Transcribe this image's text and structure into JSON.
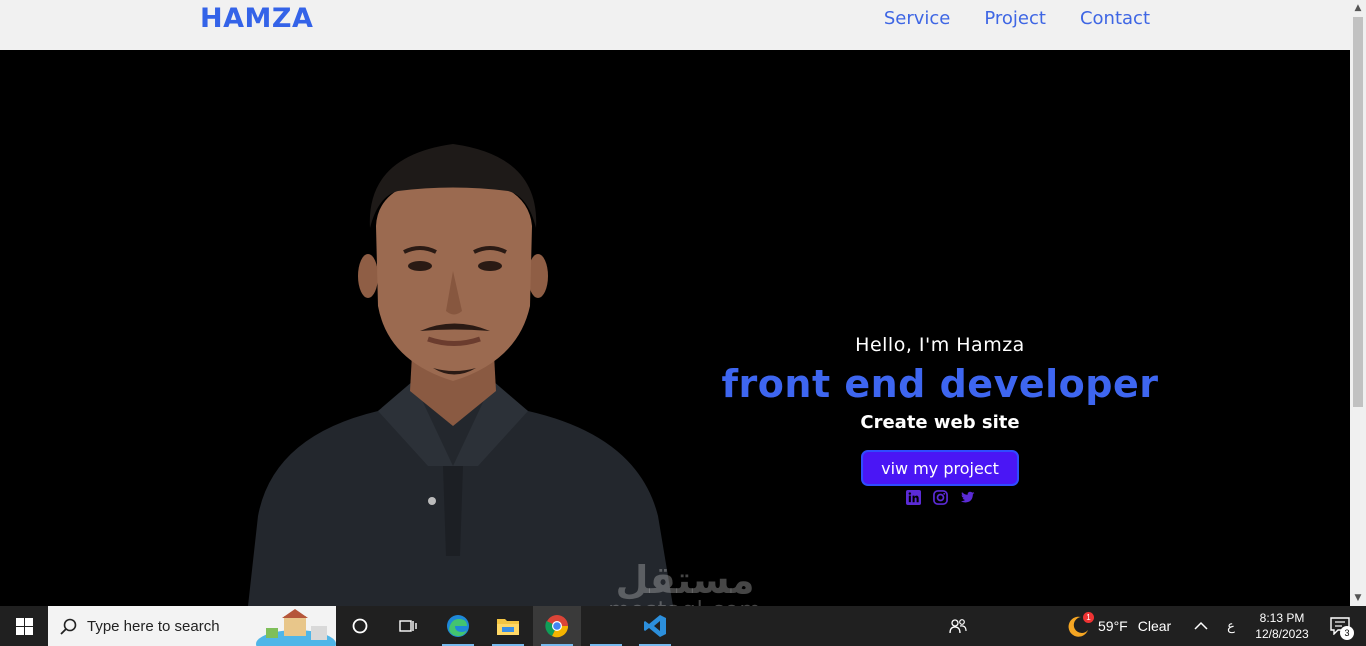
{
  "header": {
    "logo": "HAMZA",
    "nav": [
      "Service",
      "Project",
      "Contact"
    ]
  },
  "hero": {
    "greeting": "Hello, I'm Hamza",
    "role": "front end developer",
    "tagline": "Create web site",
    "cta_label": "viw my project",
    "socials": [
      "linkedin-icon",
      "instagram-icon",
      "twitter-icon"
    ]
  },
  "watermark": {
    "arabic": "مستقل",
    "latin": "mostaql.com"
  },
  "taskbar": {
    "search_placeholder": "Type here to search",
    "weather": {
      "temp": "59°F",
      "condition": "Clear",
      "alert_count": "1"
    },
    "language": "ع",
    "time": "8:13 PM",
    "date": "12/8/2023",
    "notification_count": "3"
  },
  "colors": {
    "accent": "#3e66f0",
    "button": "#4a16f5",
    "social": "#5b2bd6"
  }
}
